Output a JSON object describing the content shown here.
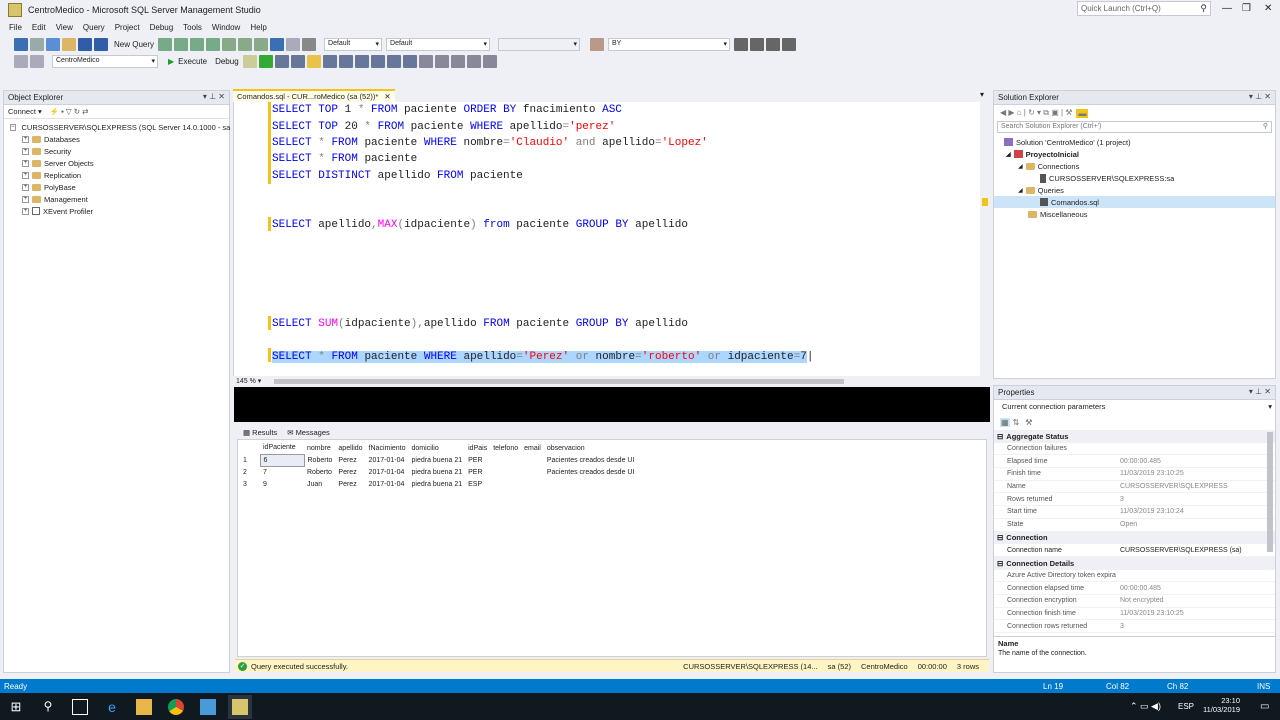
{
  "window": {
    "title": "CentroMedico - Microsoft SQL Server Management Studio",
    "quick_launch": "Quick Launch (Ctrl+Q)"
  },
  "menu": [
    "File",
    "Edit",
    "View",
    "Query",
    "Project",
    "Debug",
    "Tools",
    "Window",
    "Help"
  ],
  "toolbar": {
    "new_query": "New Query",
    "config1": "Default",
    "config2": "Default",
    "group_by": "BY",
    "database": "CentroMedico",
    "execute": "Execute",
    "debug": "Debug"
  },
  "object_explorer": {
    "title": "Object Explorer",
    "connect": "Connect",
    "server": "CURSOSSERVER\\SQLEXPRESS (SQL Server 14.0.1000 - sa",
    "nodes": [
      "Databases",
      "Security",
      "Server Objects",
      "Replication",
      "PolyBase",
      "Management",
      "XEvent Profiler"
    ]
  },
  "editor": {
    "tab_title": "Comandos.sql - CUR...roMedico (sa (52))*",
    "zoom": "145 %"
  },
  "results": {
    "tabs": [
      "Results",
      "Messages"
    ],
    "columns": [
      "",
      "idPaciente",
      "nombre",
      "apellido",
      "fNacimiento",
      "domicilio",
      "idPais",
      "telefono",
      "email",
      "observacion"
    ],
    "rows": [
      [
        "1",
        "6",
        "Roberto",
        "Perez",
        "2017-01-04",
        "piedra buena 21",
        "PER",
        "",
        "",
        "Pacientes creados desde UI"
      ],
      [
        "2",
        "7",
        "Roberto",
        "Perez",
        "2017-01-04",
        "piedra buena 21",
        "PER",
        "",
        "",
        "Pacientes creados desde UI"
      ],
      [
        "3",
        "9",
        "Juan",
        "Perez",
        "2017-01-04",
        "piedra buena 21",
        "ESP",
        "",
        "",
        ""
      ]
    ]
  },
  "status": {
    "message": "Query executed successfully.",
    "server": "CURSOSSERVER\\SQLEXPRESS (14...",
    "user": "sa (52)",
    "db": "CentroMedico",
    "time": "00:00:00",
    "rows": "3 rows"
  },
  "solution_explorer": {
    "title": "Solution Explorer",
    "search": "Search Solution Explorer (Ctrl+')",
    "solution": "Solution 'CentroMedico' (1 project)",
    "project": "ProyectoInicial",
    "connections": "Connections",
    "conn": "CURSOSSERVER\\SQLEXPRESS:sa",
    "queries": "Queries",
    "file": "Comandos.sql",
    "misc": "Miscellaneous"
  },
  "properties": {
    "title": "Properties",
    "selector": "Current connection parameters",
    "sections": [
      {
        "name": "Aggregate Status",
        "items": [
          [
            "Connection failures",
            ""
          ],
          [
            "Elapsed time",
            "00:00:00.485"
          ],
          [
            "Finish time",
            "11/03/2019 23:10:25"
          ],
          [
            "Name",
            "CURSOSSERVER\\SQLEXPRESS"
          ],
          [
            "Rows returned",
            "3"
          ],
          [
            "Start time",
            "11/03/2019 23:10:24"
          ],
          [
            "State",
            "Open"
          ]
        ]
      },
      {
        "name": "Connection",
        "items": [
          [
            "Connection name",
            "CURSOSSERVER\\SQLEXPRESS (sa)"
          ]
        ]
      },
      {
        "name": "Connection Details",
        "items": [
          [
            "Azure Active Directory token expira",
            ""
          ],
          [
            "Connection elapsed time",
            "00:00:00.485"
          ],
          [
            "Connection encryption",
            "Not encrypted"
          ],
          [
            "Connection finish time",
            "11/03/2019 23:10:25"
          ],
          [
            "Connection rows returned",
            "3"
          ]
        ]
      }
    ],
    "desc_title": "Name",
    "desc_text": "The name of the connection."
  },
  "app_status": {
    "ready": "Ready",
    "ln": "Ln 19",
    "col": "Col 82",
    "ch": "Ch 82",
    "ins": "INS"
  },
  "taskbar": {
    "lang": "ESP",
    "time": "23:10",
    "date": "11/03/2019"
  },
  "colors": {
    "accent": "#007acc",
    "selection": "#add6ff",
    "keyword": "#0000ff",
    "string": "#ff0000",
    "function": "#ff00ff"
  }
}
